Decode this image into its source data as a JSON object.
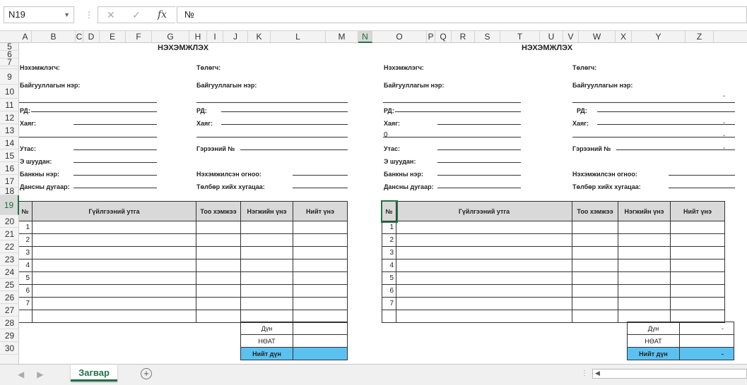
{
  "formula_bar": {
    "name_box": "N19",
    "cancel_icon": "✕",
    "enter_icon": "✓",
    "fx_icon": "fx",
    "content": "№"
  },
  "columns": [
    "A",
    "B",
    "C",
    "D",
    "E",
    "F",
    "G",
    "H",
    "I",
    "J",
    "K",
    "L",
    "M",
    "N",
    "O",
    "P",
    "Q",
    "R",
    "S",
    "T",
    "U",
    "V",
    "W",
    "X",
    "Y",
    "Z"
  ],
  "rows": [
    "5",
    "6",
    "7",
    "8",
    "9",
    "10",
    "11",
    "12",
    "13",
    "14",
    "15",
    "16",
    "17",
    "18",
    "19",
    "20",
    "21",
    "22",
    "23",
    "24",
    "25",
    "26",
    "27",
    "28",
    "29",
    "30"
  ],
  "selected": {
    "column": "N",
    "row": "19"
  },
  "invoices": [
    {
      "title": "НЭХЭМЖЛЭХ",
      "left_labels": {
        "sender": "Нэхэмжлэгч:",
        "org": "Байгууллагын нэр:",
        "rd": "РД:",
        "address": "Хаяг:",
        "phone": "Утас:",
        "email": "Э шуудан:",
        "bank": "Банкны нэр:",
        "account": "Дансны дугаар:"
      },
      "left_values": {
        "address2": ""
      },
      "right_labels": {
        "payer": "Төлөгч:",
        "org": "Байгууллагын нэр:",
        "rd": "РД:",
        "address": "Хаяг:",
        "contract": "Гэрээний №",
        "date": "Нэхэмжилсэн огноо:",
        "due": "Төлбөр хийх хугацаа:"
      },
      "right_values": {
        "org2": "",
        "address1": "",
        "address2": "",
        "contract": ""
      },
      "table_headers": {
        "num": "№",
        "desc": "Гүйлгээний утга",
        "qty": "Тоо хэмжээ",
        "unit": "Нэгжийн үнэ",
        "total": "Нийт үнэ"
      },
      "rows": [
        "1",
        "2",
        "3",
        "4",
        "5",
        "6",
        "7",
        ""
      ],
      "summary": {
        "subtotal_label": "Дүн",
        "vat_label": "НӨАТ",
        "total_label": "Нийт дүн",
        "subtotal": "",
        "vat": "",
        "total": ""
      }
    },
    {
      "title": "НЭХЭМЖЛЭХ",
      "left_labels": {
        "sender": "Нэхэмжлэгч:",
        "org": "Байгууллагын нэр:",
        "rd": "РД:",
        "address": "Хаяг:",
        "phone": "Утас:",
        "email": "Э шуудан:",
        "bank": "Банкны нэр:",
        "account": "Дансны дугаар:"
      },
      "left_values": {
        "address2": "0"
      },
      "right_labels": {
        "payer": "Төлөгч:",
        "org": "Байгууллагын нэр:",
        "rd": "РД:",
        "address": "Хаяг:",
        "contract": "Гэрээний №",
        "date": "Нэхэмжилсэн огноо:",
        "due": "Төлбөр хийх хугацаа:"
      },
      "right_values": {
        "org2": "-",
        "address1": "-",
        "address2": "-",
        "contract": "-"
      },
      "table_headers": {
        "num": "№",
        "desc": "Гүйлгээний утга",
        "qty": "Тоо хэмжээ",
        "unit": "Нэгжийн үнэ",
        "total": "Нийт үнэ"
      },
      "rows": [
        "1",
        "2",
        "3",
        "4",
        "5",
        "6",
        "7",
        ""
      ],
      "summary": {
        "subtotal_label": "Дүн",
        "vat_label": "НӨАТ",
        "total_label": "Нийт дүн",
        "subtotal": "-",
        "vat": "",
        "total": "-"
      }
    }
  ],
  "sheet_tab": "Загвар",
  "add_sheet_icon": "⊕"
}
